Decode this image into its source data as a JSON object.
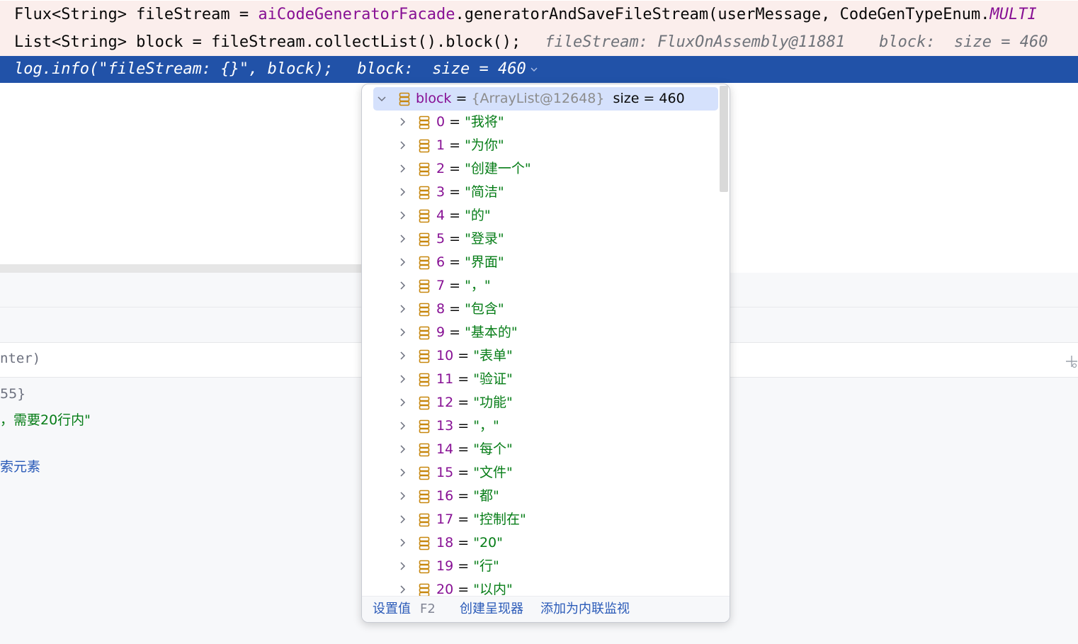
{
  "code": {
    "line1": {
      "text_a": "Flux<String> fileStream = ",
      "field": "aiCodeGeneratorFacade",
      "text_b": ".generatorAndSaveFileStream(userMessage, CodeGenTypeEnum.",
      "enum_const": "MULTI"
    },
    "line2": {
      "text": "List<String> block = fileStream.collectList().block();",
      "hint1": "fileStream: FluxOnAssembly@11881",
      "hint2": "block:  size = 460"
    },
    "line3": {
      "text": "log.info(\"fileStream: {}\", block);",
      "hint": "block:  size = 460"
    }
  },
  "background": {
    "eval_text": "nter)",
    "clip1": "55}",
    "clip2": "，需要20行内\"",
    "clip3": "索元素"
  },
  "popup": {
    "root": {
      "name": "block",
      "eq": "=",
      "type": "{ArrayList@12648}",
      "size": "size = 460"
    },
    "items": [
      {
        "index": "0",
        "value": "\"我将\""
      },
      {
        "index": "1",
        "value": "\"为你\""
      },
      {
        "index": "2",
        "value": "\"创建一个\""
      },
      {
        "index": "3",
        "value": "\"简洁\""
      },
      {
        "index": "4",
        "value": "\"的\""
      },
      {
        "index": "5",
        "value": "\"登录\""
      },
      {
        "index": "6",
        "value": "\"界面\""
      },
      {
        "index": "7",
        "value": "\"，\""
      },
      {
        "index": "8",
        "value": "\"包含\""
      },
      {
        "index": "9",
        "value": "\"基本的\""
      },
      {
        "index": "10",
        "value": "\"表单\""
      },
      {
        "index": "11",
        "value": "\"验证\""
      },
      {
        "index": "12",
        "value": "\"功能\""
      },
      {
        "index": "13",
        "value": "\"，\""
      },
      {
        "index": "14",
        "value": "\"每个\""
      },
      {
        "index": "15",
        "value": "\"文件\""
      },
      {
        "index": "16",
        "value": "\"都\""
      },
      {
        "index": "17",
        "value": "\"控制在\""
      },
      {
        "index": "18",
        "value": "\"20\""
      },
      {
        "index": "19",
        "value": "\"行\""
      },
      {
        "index": "20",
        "value": "\"以内\""
      }
    ],
    "footer": {
      "set_value": "设置值",
      "set_value_key": "F2",
      "create_renderer": "创建呈现器",
      "add_inline_watch": "添加为内联监视"
    }
  },
  "colors": {
    "string_green": "#067d17",
    "field_purple": "#871094",
    "exec_line_blue": "#2152a8",
    "breakpoint_pink": "#fbeeec",
    "selection_blue": "#d5e1fc",
    "icon_orange": "#c7870e"
  },
  "icons": {
    "tree_expand": "chevron-right-icon",
    "tree_collapse": "chevron-down-icon",
    "field": "field-icon"
  }
}
